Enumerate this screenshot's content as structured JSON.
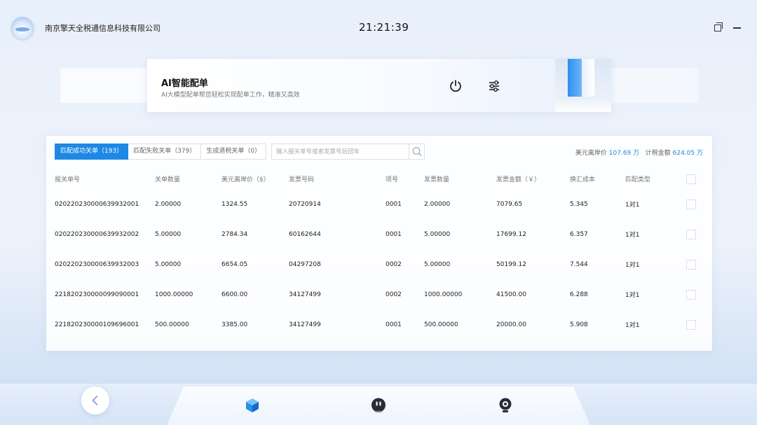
{
  "header": {
    "company": "南京擎天全税通信息科技有限公司",
    "time": "21:21:39",
    "icons": [
      "logo",
      "restore-icon",
      "minimize-icon"
    ]
  },
  "banner": {
    "title": "AI智能配单",
    "subtitle": "AI大模型配单帮您轻松实现配单工作，精准又高效",
    "icons": [
      "power-icon",
      "settings-sliders-icon"
    ]
  },
  "tabs": [
    {
      "label": "匹配成功关单（193）",
      "active": true
    },
    {
      "label": "匹配失败关单（379）",
      "active": false
    },
    {
      "label": "生成退税关单（0）",
      "active": false
    }
  ],
  "search": {
    "placeholder": "输入报关单号或者发票号后回车",
    "value": ""
  },
  "summary": {
    "usd_label": "美元离岸价",
    "usd_value": "107.69 万",
    "tax_label": "计税金额",
    "tax_value": "624.05 万"
  },
  "table": {
    "columns": [
      "报关单号",
      "关单数量",
      "美元离岸价（$）",
      "发票号码",
      "项号",
      "发票数量",
      "发票金额（￥）",
      "换汇成本",
      "匹配类型"
    ],
    "rows": [
      [
        "020220230000639932001",
        "2.00000",
        "1324.55",
        "20720914",
        "0001",
        "2.00000",
        "7079.65",
        "5.345",
        "1对1"
      ],
      [
        "020220230000639932002",
        "5.00000",
        "2784.34",
        "60162644",
        "0001",
        "5.00000",
        "17699.12",
        "6.357",
        "1对1"
      ],
      [
        "020220230000639932003",
        "5.00000",
        "6654.05",
        "04297208",
        "0002",
        "5.00000",
        "50199.12",
        "7.544",
        "1对1"
      ],
      [
        "221820230000099090001",
        "1000.00000",
        "6600.00",
        "34127499",
        "0002",
        "1000.00000",
        "41500.00",
        "6.288",
        "1对1"
      ],
      [
        "221820230000109696001",
        "500.00000",
        "3385.00",
        "34127499",
        "0001",
        "500.00000",
        "20000.00",
        "5.908",
        "1对1"
      ]
    ]
  },
  "dock": {
    "icons": [
      "back-arrow-icon",
      "cube-icon",
      "robot-icon",
      "camera-icon"
    ]
  },
  "colors": {
    "accent": "#1e88e5",
    "background": "#e8f0fb"
  }
}
